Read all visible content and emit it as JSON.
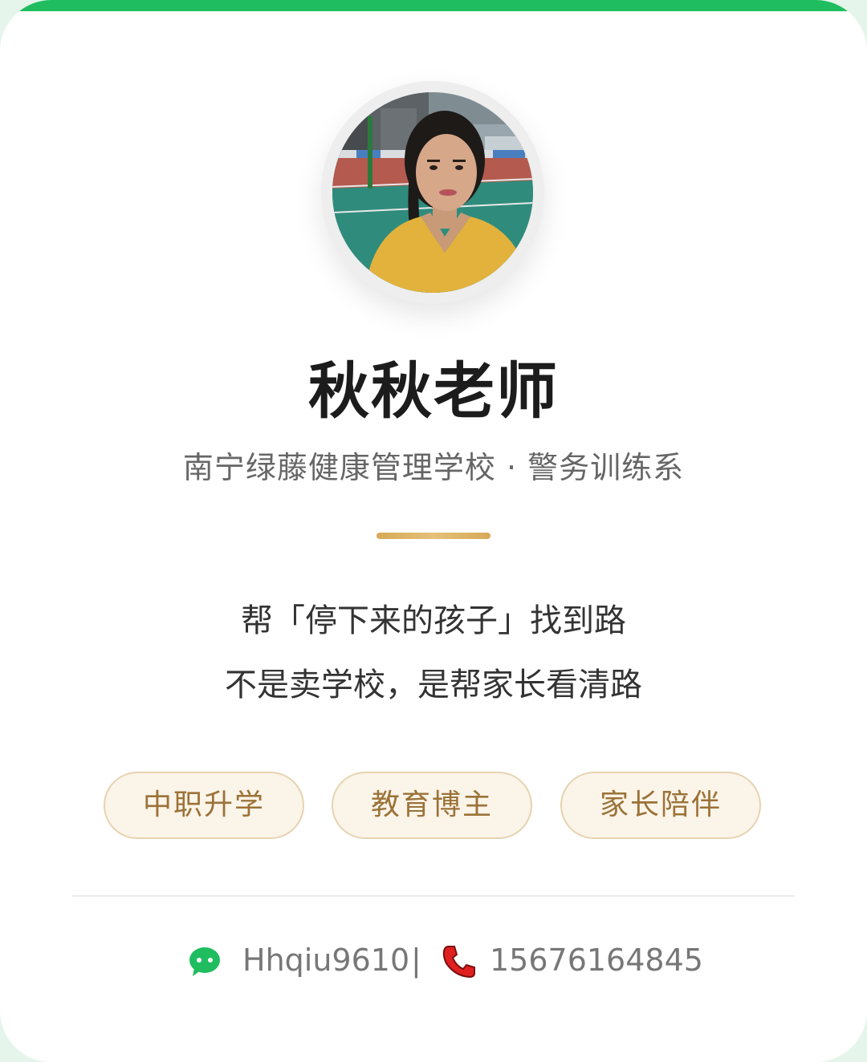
{
  "profile": {
    "name": "秋秋老师",
    "organization": "南宁绿藤健康管理学校 · 警务训练系"
  },
  "slogan": {
    "line1": "帮「停下来的孩子」找到路",
    "line2": "不是卖学校，是帮家长看清路"
  },
  "tags": [
    "中职升学",
    "教育博主",
    "家长陪伴"
  ],
  "contact": {
    "wechat_icon": "wechat-icon",
    "wechat_id": "Hhqiu9610",
    "separator": "|",
    "phone_icon": "phone-icon",
    "phone": "15676164845"
  },
  "colors": {
    "accent": "#1fbd5f",
    "gold": "#d6a955",
    "tag_text": "#9b7238",
    "tag_bg": "#fbf4e8",
    "phone_icon": "#e02020"
  }
}
